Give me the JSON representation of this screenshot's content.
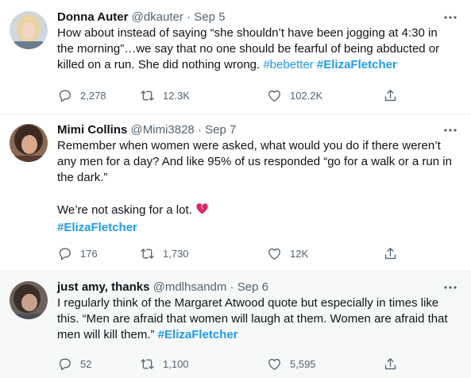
{
  "tweets": [
    {
      "name": "Donna Auter",
      "handle": "@dkauter",
      "dot": "·",
      "date": "Sep 5",
      "text_lines": [
        "How about instead of saying “she shouldn’t have been jogging at 4:30 in",
        "the morning”…we say that no one should be fearful of being abducted or",
        "killed on a run. She did nothing wrong. "
      ],
      "hashtag1": "#bebetter",
      "hashtag2": "#ElizaFletcher",
      "replies": "2,278",
      "retweets": "12.3K",
      "likes": "102.2K"
    },
    {
      "name": "Mimi Collins",
      "handle": "@Mimi3828",
      "dot": "·",
      "date": "Sep 7",
      "text_lines": [
        "Remember when women were asked, what would you do if there weren’t",
        "any men for a day? And like 95% of us responded “go for a walk or a run in",
        "the dark.”"
      ],
      "text_line4": "We’re not asking for a lot. ",
      "hashtag": "#ElizaFletcher",
      "replies": "176",
      "retweets": "1,730",
      "likes": "12K"
    },
    {
      "name": "just amy, thanks",
      "handle": "@mdlhsandm",
      "dot": "·",
      "date": "Sep 6",
      "text_lines": [
        "I regularly think of the Margaret Atwood quote but especially in times like",
        "this. “Men are afraid that women will laugh at them. Women are afraid that",
        "men will kill them.” "
      ],
      "hashtag": "#ElizaFletcher",
      "replies": "52",
      "retweets": "1,100",
      "likes": "5,595"
    }
  ],
  "icons": {
    "more": "more-icon",
    "reply": "reply-icon",
    "retweet": "retweet-icon",
    "like": "heart-icon",
    "share": "share-icon",
    "emoji": "broken-heart-emoji"
  },
  "colors": {
    "hashtag": "#1d9bf0",
    "secondary_text": "#536471",
    "primary_text": "#0f1419",
    "hover_background": "#f7f9f9",
    "broken_heart": "#e0245e"
  }
}
